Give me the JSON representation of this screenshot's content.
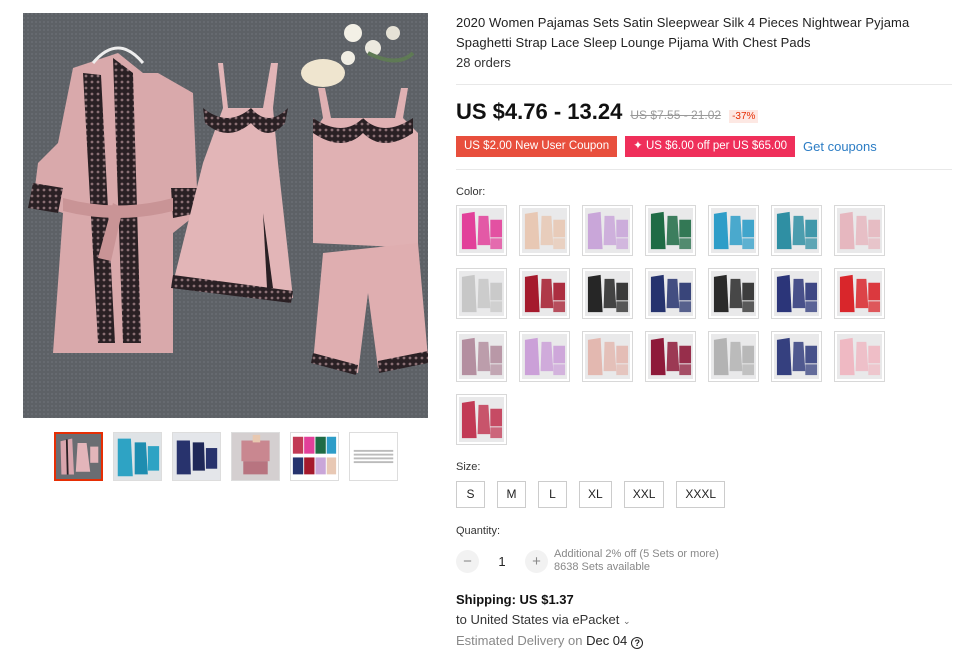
{
  "product": {
    "title": "2020 Women Pajamas Sets Satin Sleepwear Silk 4 Pieces Nightwear Pyjama Spaghetti Strap Lace Sleep Lounge Pijama With Chest Pads",
    "orders": "28 orders",
    "price": "US $4.76 - 13.24",
    "old_price": "US $7.55 - 21.02",
    "discount": "-37%"
  },
  "coupons": {
    "new_user": "US $2.00 New User Coupon",
    "store": "US $6.00 off per US $65.00",
    "store_icon": "plus-diamond-icon",
    "get": "Get coupons"
  },
  "color": {
    "label": "Color:",
    "swatches": [
      {
        "name": "hot-pink",
        "color": "#e2409a"
      },
      {
        "name": "champagne",
        "color": "#e8c8b4"
      },
      {
        "name": "lilac",
        "color": "#c9a6d9"
      },
      {
        "name": "dark-green",
        "color": "#1f6b45"
      },
      {
        "name": "sky-blue",
        "color": "#2e9dc8"
      },
      {
        "name": "teal",
        "color": "#2f8fa3"
      },
      {
        "name": "pink-lace",
        "color": "#e6b7bf"
      },
      {
        "name": "silver",
        "color": "#c7c7c7"
      },
      {
        "name": "wine-red",
        "color": "#a51a2d"
      },
      {
        "name": "black",
        "color": "#262626"
      },
      {
        "name": "navy",
        "color": "#26336e"
      },
      {
        "name": "black-white",
        "color": "#2a2a2a"
      },
      {
        "name": "navy-white",
        "color": "#2b3579"
      },
      {
        "name": "red-white",
        "color": "#d9262b"
      },
      {
        "name": "mauve",
        "color": "#b48fa0"
      },
      {
        "name": "lavender",
        "color": "#cba0d8"
      },
      {
        "name": "rose-mix",
        "color": "#e3b8b0"
      },
      {
        "name": "burgundy",
        "color": "#8e1a3a"
      },
      {
        "name": "grey",
        "color": "#b3b3b3"
      },
      {
        "name": "royal-blue",
        "color": "#35407f"
      },
      {
        "name": "blush",
        "color": "#efb9c3"
      },
      {
        "name": "rose-red",
        "color": "#c23a55"
      }
    ]
  },
  "size": {
    "label": "Size:",
    "options": [
      "S",
      "M",
      "L",
      "XL",
      "XXL",
      "XXXL"
    ]
  },
  "quantity": {
    "label": "Quantity:",
    "value": "1",
    "minus": "−",
    "plus": "+",
    "note1": "Additional 2% off (5 Sets or more)",
    "note2": "8638 Sets available"
  },
  "shipping": {
    "label": "Shipping: US $1.37",
    "to": "to United States via ePacket",
    "chevron_icon": "chevron-down-icon",
    "delivery_prefix": "Estimated Delivery on",
    "delivery_date": "Dec 04",
    "help_icon": "question-circle-icon"
  },
  "gallery": {
    "thumbs": [
      {
        "name": "pink-set",
        "color": "#d9a5ad"
      },
      {
        "name": "blue-set",
        "color": "#2ea3c4"
      },
      {
        "name": "navy-set",
        "color": "#28336d"
      },
      {
        "name": "pink-model",
        "color": "#c98790"
      },
      {
        "name": "color-chart",
        "color": "#c23a55"
      },
      {
        "name": "size-chart",
        "color": "#eeeeee"
      }
    ]
  }
}
